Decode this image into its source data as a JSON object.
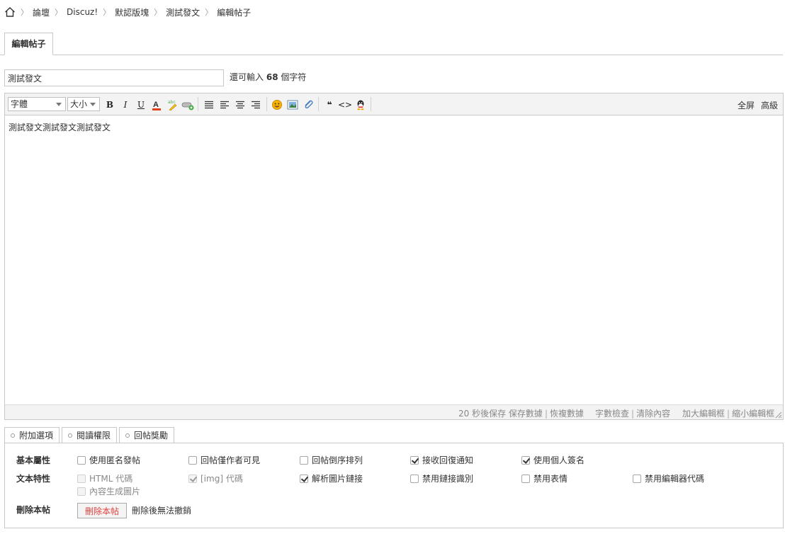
{
  "breadcrumb": {
    "items": [
      "論壇",
      "Discuz!",
      "默認版塊",
      "測試發文",
      "編輯帖子"
    ]
  },
  "tab": {
    "label": "編輯帖子"
  },
  "subject": {
    "value": "測試發文",
    "remain_prefix": "還可輸入",
    "remain_count": "68",
    "remain_suffix": "個字符"
  },
  "toolbar": {
    "font_label": "字體",
    "size_label": "大小",
    "fullscreen": "全屏",
    "advanced": "高級",
    "icons": [
      "bold-icon",
      "italic-icon",
      "underline-icon",
      "font-color-icon",
      "highlight-icon",
      "link-icon",
      "align-left-icon",
      "align-justify-icon",
      "align-center-icon",
      "align-right-icon",
      "smiley-icon",
      "image-icon",
      "attachment-icon",
      "quote-icon",
      "code-icon",
      "qq-icon"
    ],
    "bold": "B",
    "italic": "I",
    "underline": "U",
    "color": "A",
    "quote": "❝",
    "code": "<>"
  },
  "editor": {
    "content": "測試發文測試發文測試發文"
  },
  "statusbar": {
    "autosave": "20 秒後保存",
    "save": "保存數據",
    "restore": "恢複數據",
    "wordcount": "字數檢查",
    "clear": "清除內容",
    "enlarge": "加大編輯框",
    "shrink": "縮小編輯框"
  },
  "option_tabs": [
    "附加選項",
    "閱讀權限",
    "回帖獎勵"
  ],
  "options": {
    "basic_label": "基本屬性",
    "basic": [
      {
        "label": "使用匿名發帖",
        "checked": false
      },
      {
        "label": "回帖僅作者可見",
        "checked": false
      },
      {
        "label": "回帖倒序排列",
        "checked": false
      },
      {
        "label": "接收回復通知",
        "checked": true
      },
      {
        "label": "使用個人簽名",
        "checked": true
      }
    ],
    "text_label": "文本特性",
    "text": [
      {
        "label": "HTML 代碼",
        "checked": false,
        "disabled": true
      },
      {
        "label": "[img] 代碼",
        "checked": true,
        "disabled": true
      },
      {
        "label": "解析圖片鏈接",
        "checked": true,
        "disabled": false
      },
      {
        "label": "禁用鏈接識別",
        "checked": false,
        "disabled": false
      },
      {
        "label": "禁用表情",
        "checked": false,
        "disabled": false
      },
      {
        "label": "禁用編輯器代碼",
        "checked": false,
        "disabled": false
      },
      {
        "label": "內容生成圖片",
        "checked": false,
        "disabled": true
      }
    ],
    "delete_label": "刪除本帖",
    "delete_button": "刪除本帖",
    "delete_note": "刪除後無法撤銷"
  }
}
